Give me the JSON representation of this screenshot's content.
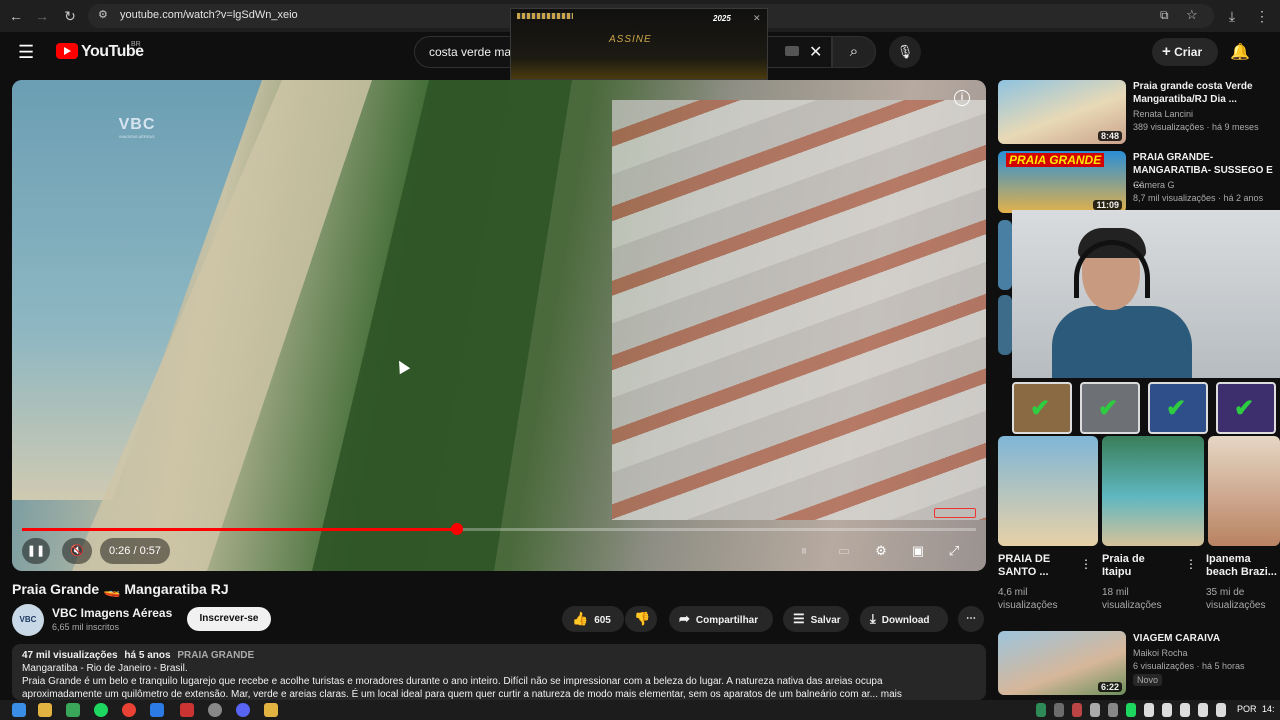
{
  "browser": {
    "url": "youtube.com/watch?v=lgSdWn_xeio"
  },
  "header": {
    "logo_text": "YouTube",
    "region": "BR",
    "search_value": "costa verde ma",
    "create_label": "Criar"
  },
  "ad": {
    "text": "ASSINE",
    "brand": "2025"
  },
  "player": {
    "watermark": "VBC",
    "watermark_sub": "IMAGENS AÉREAS",
    "time": "0:26 / 0:57",
    "progress": 0.456
  },
  "video": {
    "title": "Praia Grande 🚤 Mangaratiba RJ",
    "channel": "VBC Imagens Aéreas",
    "subscribers": "6,65 mil inscritos",
    "avatar_text": "VBC",
    "subscribe_label": "Inscrever-se",
    "likes": "605",
    "share_label": "Compartilhar",
    "save_label": "Salvar",
    "download_label": "Download"
  },
  "description": {
    "views": "47 mil visualizações",
    "age": "há 5 anos",
    "tag": "PRAIA GRANDE",
    "line1": "Mangaratiba - Rio de Janeiro - Brasil.",
    "line2": "Praia Grande é um belo e tranquilo lugarejo que recebe e acolhe turistas e moradores durante o ano inteiro. Difícil não se impressionar com a beleza do lugar. A natureza nativa das areias ocupa",
    "line3": "aproximadamente um quilômetro de extensão. Mar, verde e areias claras. É um local ideal para quem quer curtir a natureza de modo mais elementar, sem os aparatos de um balneário com ar... mais"
  },
  "sidebar": {
    "items": [
      {
        "title1": "Praia grande costa Verde",
        "title2": "Mangaratiba/RJ Dia ...",
        "channel": "Renata Lancini",
        "stats": "389 visualizações · há 9 meses",
        "duration": "8:48"
      },
      {
        "title1": "PRAIA GRANDE-",
        "title2": "MANGARATIBA- SUSSEGO E ...",
        "channel": "Câmera G",
        "stats": "8,7 mil visualizações · há 2 anos",
        "duration": "11:09",
        "thumb_text": "PRAIA GRANDE"
      },
      {
        "title1": "VIAGEM CARAIVA",
        "title2": "",
        "channel": "Maikoi Rocha",
        "stats": "6 visualizações · há 5 horas",
        "duration": "6:22",
        "badge": "Novo"
      }
    ],
    "shorts": [
      {
        "title1": "PRAIA DE",
        "title2": "SANTO ...",
        "views1": "4,6 mil",
        "views2": "visualizações"
      },
      {
        "title1": "Praia de",
        "title2": "Itaipu",
        "views1": "18 mil",
        "views2": "visualizações"
      },
      {
        "title1": "Ipanema",
        "title2": "beach Brazi...",
        "views1": "35 mi de",
        "views2": "visualizações"
      }
    ]
  },
  "taskbar": {
    "lang": "POR",
    "clock": "14:"
  }
}
